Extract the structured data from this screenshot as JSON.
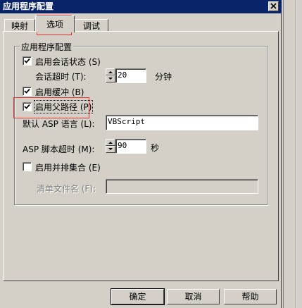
{
  "window": {
    "title": "应用程序配置"
  },
  "tabs": [
    {
      "label": "映射"
    },
    {
      "label": "选项"
    },
    {
      "label": "调试"
    }
  ],
  "group": {
    "title": "应用程序配置"
  },
  "options": {
    "session_state": {
      "label": "启用会话状态 (S)",
      "checked": true
    },
    "session_timeout": {
      "label": "会话超时 (T):",
      "value": "20",
      "unit": "分钟"
    },
    "buffering": {
      "label": "启用缓冲 (B)",
      "checked": true
    },
    "parent_paths": {
      "label": "启用父路径 (P)",
      "checked": true
    },
    "default_language": {
      "label": "默认 ASP 语言 (L):",
      "value": "VBScript"
    },
    "script_timeout": {
      "label": "ASP 脚本超时 (M):",
      "value": "90",
      "unit": "秒"
    },
    "side_by_side": {
      "label": "启用并排集合 (E)",
      "checked": false
    },
    "manifest": {
      "label": "清单文件名 (F):",
      "value": ""
    }
  },
  "buttons": {
    "ok": "确定",
    "cancel": "取消",
    "help": "帮助"
  }
}
